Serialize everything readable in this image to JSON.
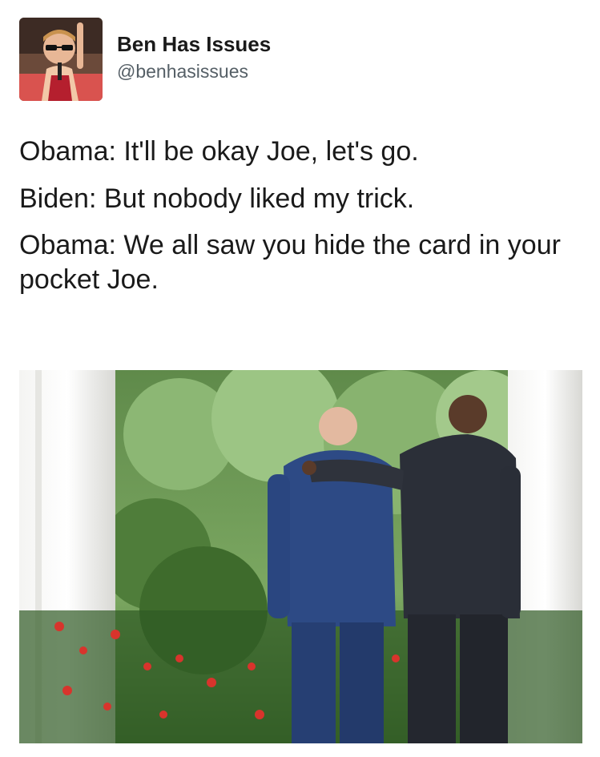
{
  "tweet": {
    "display_name": "Ben Has Issues",
    "handle": "@benhasissues",
    "avatar_icon": "child-with-sunglasses-avatar",
    "lines": [
      "Obama: It'll be okay Joe, let's go.",
      "Biden: But nobody liked my trick.",
      "Obama: We all saw you hide the card in your pocket Joe."
    ]
  },
  "photo": {
    "subject": "two men in suits walking away between white columns past red flowers"
  },
  "colors": {
    "background": "#ffffff",
    "text": "#1a1a1a",
    "handle": "#555f66"
  }
}
